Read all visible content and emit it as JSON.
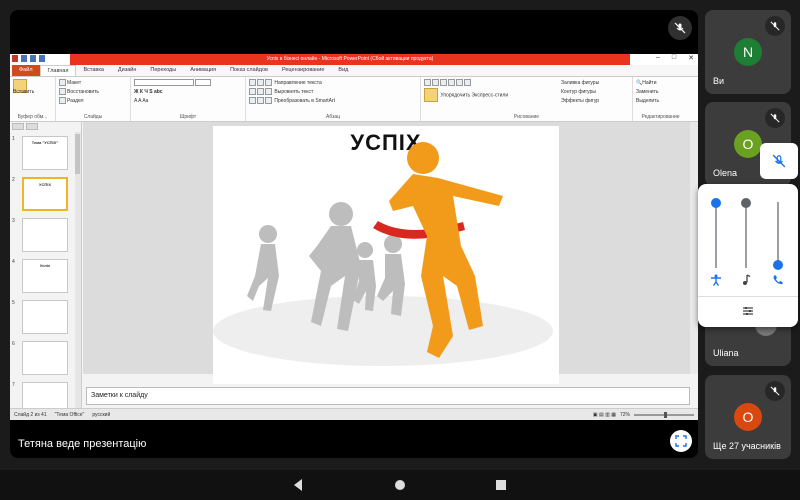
{
  "meeting": {
    "presenter_label": "Тетяна веде презентацію",
    "more_participants": "Ще 27 учасників"
  },
  "participants": [
    {
      "initial": "N",
      "name": "Ви",
      "color": "#1e7e34"
    },
    {
      "initial": "O",
      "name": "Olena",
      "color": "#6aa121"
    },
    {
      "initial": "",
      "name": "Uliana",
      "color": "#888888"
    },
    {
      "initial": "O",
      "name": "",
      "color": "#d9480f"
    }
  ],
  "ppt": {
    "window_title": "Успіх в бізнесі онлайн - Microsoft PowerPoint (Сбой активации продукта)",
    "tabs": [
      "Файл",
      "Главная",
      "Вставка",
      "Дизайн",
      "Переходы",
      "Анимация",
      "Показ слайдов",
      "Рецензирование",
      "Вид"
    ],
    "active_tab": "Главная",
    "ribbon": {
      "paste": "Вставить",
      "clipboard_group": "Буфер обм...",
      "new_slide": "Создать слайд",
      "layout": "Макет",
      "reset": "Восстановить",
      "section": "Раздел",
      "slides_group": "Слайды",
      "font_group": "Шрифт",
      "paragraph_group": "Абзац",
      "text_direction": "Направление текста",
      "align_text": "Выровнять текст",
      "smartart": "Преобразовать в SmartArt",
      "arrange": "Упорядочить",
      "quick_styles": "Экспресс-стили",
      "shape_fill": "Заливка фигуры",
      "shape_outline": "Контур фигуры",
      "shape_effects": "Эффекты фигур",
      "drawing_group": "Рисование",
      "find": "Найти",
      "replace": "Заменить",
      "select": "Выделить",
      "editing_group": "Редактирование"
    },
    "thumbnails": [
      {
        "num": "1",
        "label": "Тема \"УСПІХ\""
      },
      {
        "num": "2",
        "label": "УСПІХ"
      },
      {
        "num": "3",
        "label": ""
      },
      {
        "num": "4",
        "label": "Успіх"
      },
      {
        "num": "5",
        "label": ""
      },
      {
        "num": "6",
        "label": ""
      },
      {
        "num": "7",
        "label": ""
      }
    ],
    "slide_title": "УСПІХ",
    "notes_placeholder": "Заметки к слайду",
    "status": {
      "slide_info": "Слайд 2 из 41",
      "theme": "\"Тема Office\"",
      "language": "русский",
      "zoom": "72%"
    }
  },
  "popup": {
    "levels": [
      0.0,
      0.0,
      1.0
    ]
  },
  "colors": {
    "accent_blue": "#1a73e8",
    "ppt_red": "#e8331f",
    "runner_orange": "#f29a1a"
  }
}
